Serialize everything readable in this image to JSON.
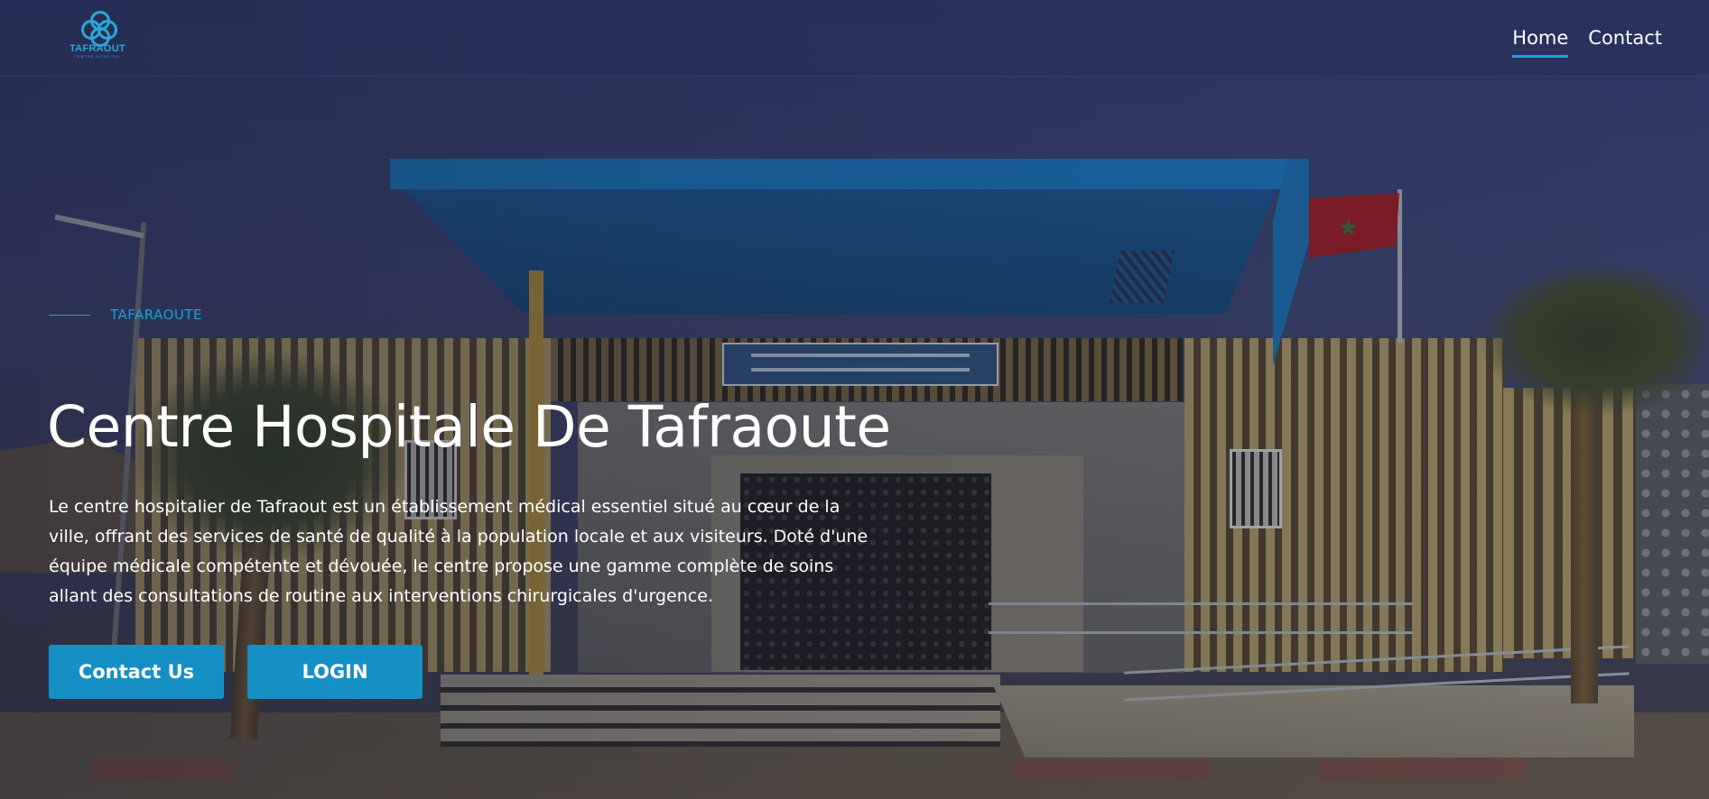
{
  "header": {
    "logo_text": "TAFRAOUT",
    "logo_subtext": "CENTRE HOSPITAL",
    "nav": [
      {
        "label": "Home",
        "active": true
      },
      {
        "label": "Contact",
        "active": false
      }
    ]
  },
  "hero": {
    "eyebrow": "TAFARAOUTE",
    "title": "Centre Hospitale De Tafraoute",
    "description": "Le centre hospitalier de Tafraout est un établissement médical essentiel situé au cœur de la ville, offrant des services de santé de qualité à la population locale et aux visiteurs. Doté d'une équipe médicale compétente et dévouée, le centre propose une gamme complète de soins allant des consultations de routine aux interventions chirurgicales d'urgence.",
    "buttons": {
      "contact_label": "Contact Us",
      "login_label": "LOGIN"
    }
  },
  "colors": {
    "accent": "#1e9fd8",
    "button_bg": "#1590c4",
    "header_bg": "#262f58",
    "text": "#ffffff"
  },
  "icons": {
    "logo": "medical-cross-logo-icon"
  }
}
